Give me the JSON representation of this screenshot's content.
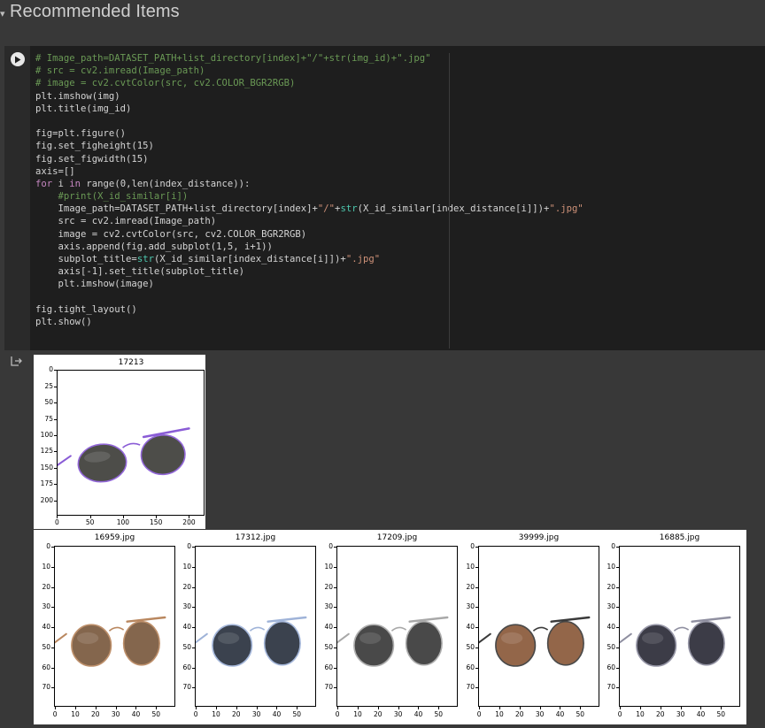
{
  "section": {
    "title": "Recommended Items"
  },
  "code_cell": {
    "lines": [
      [
        [
          "c",
          "# Image_path=DATASET_PATH+list_directory[index]+\"/\"+str(img_id)+\".jpg\""
        ]
      ],
      [
        [
          "c",
          "# src = cv2.imread(Image_path)"
        ]
      ],
      [
        [
          "c",
          "# image = cv2.cvtColor(src, cv2.COLOR_BGR2RGB)"
        ]
      ],
      [
        [
          "t",
          "plt.imshow(img)"
        ]
      ],
      [
        [
          "t",
          "plt.title(img_id)"
        ]
      ],
      [
        [
          "t",
          ""
        ]
      ],
      [
        [
          "t",
          "fig=plt.figure()"
        ]
      ],
      [
        [
          "t",
          "fig.set_figheight(15)"
        ]
      ],
      [
        [
          "t",
          "fig.set_figwidth(15)"
        ]
      ],
      [
        [
          "t",
          "axis=[]"
        ]
      ],
      [
        [
          "k",
          "for"
        ],
        [
          "t",
          " i "
        ],
        [
          "k",
          "in"
        ],
        [
          "t",
          " range(0,len(index_distance)):"
        ]
      ],
      [
        [
          "c",
          "    #print(X_id_similar[i])"
        ]
      ],
      [
        [
          "t",
          "    Image_path=DATASET_PATH+list_directory[index]+"
        ],
        [
          "s",
          "\"/\""
        ],
        [
          "t",
          "+"
        ],
        [
          "b",
          "str"
        ],
        [
          "t",
          "(X_id_similar[index_distance[i]])+"
        ],
        [
          "s",
          "\".jpg\""
        ]
      ],
      [
        [
          "t",
          "    src = cv2.imread(Image_path)"
        ]
      ],
      [
        [
          "t",
          "    image = cv2.cvtColor(src, cv2.COLOR_BGR2RGB)"
        ]
      ],
      [
        [
          "t",
          "    axis.append(fig.add_subplot(1,5, i+1))"
        ]
      ],
      [
        [
          "t",
          "    subplot_title="
        ],
        [
          "b",
          "str"
        ],
        [
          "t",
          "(X_id_similar[index_distance[i]])+"
        ],
        [
          "s",
          "\".jpg\""
        ]
      ],
      [
        [
          "t",
          "    axis[-1].set_title(subplot_title)"
        ]
      ],
      [
        [
          "t",
          "    plt.imshow(image)"
        ]
      ],
      [
        [
          "t",
          ""
        ]
      ],
      [
        [
          "t",
          "fig.tight_layout()"
        ]
      ],
      [
        [
          "t",
          "plt.show()"
        ]
      ]
    ]
  },
  "query_plot": {
    "title": "17213",
    "xticks": [
      "0",
      "50",
      "100",
      "150",
      "200"
    ],
    "yticks": [
      "0",
      "25",
      "50",
      "75",
      "100",
      "125",
      "150",
      "175",
      "200"
    ],
    "frame_color": "#8a5cd6"
  },
  "recommendations": [
    {
      "title": "16959.jpg",
      "frame_color": "#b9875f",
      "lens_color": "#7a5a3e"
    },
    {
      "title": "17312.jpg",
      "frame_color": "#9fb3d8",
      "lens_color": "#2b3340"
    },
    {
      "title": "17209.jpg",
      "frame_color": "#a8a8a8",
      "lens_color": "#3a3a3a"
    },
    {
      "title": "39999.jpg",
      "frame_color": "#3a3a3a",
      "lens_color": "#8a5a3a"
    },
    {
      "title": "16885.jpg",
      "frame_color": "#8f8fa0",
      "lens_color": "#2c2c38"
    }
  ],
  "rec_xticks": [
    "0",
    "10",
    "20",
    "30",
    "40",
    "50"
  ],
  "rec_yticks": [
    "0",
    "10",
    "20",
    "30",
    "40",
    "50",
    "60",
    "70"
  ],
  "icons": {
    "run": "play-icon",
    "output": "output-icon",
    "caret": "caret-icon"
  }
}
